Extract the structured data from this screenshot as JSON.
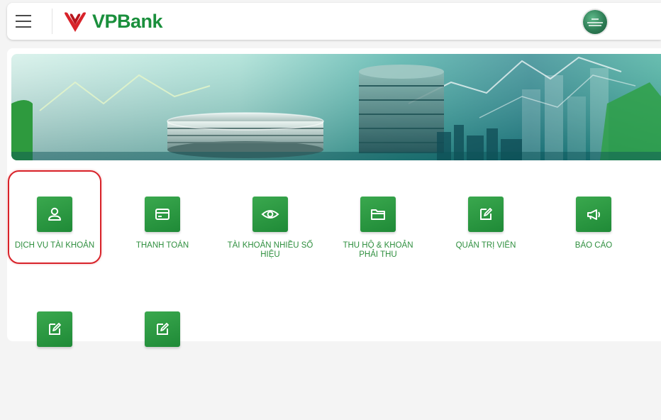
{
  "header": {
    "menu_icon": "hamburger-menu-icon",
    "logo": {
      "prefix": "VP",
      "suffix": "Bank",
      "text": "VPBank",
      "color": "#1a8f3c",
      "mark_color": "#d8232a"
    },
    "avatar_icon": "user-avatar"
  },
  "banner": {
    "description_icon": "finance-banner-image"
  },
  "services": [
    {
      "label": "DỊCH VỤ TÀI KHOẢN",
      "icon": "user-icon",
      "selected": true
    },
    {
      "label": "THANH TOÁN",
      "icon": "card-icon",
      "selected": false
    },
    {
      "label": "TÀI KHOẢN NHIỀU SỐ HIỆU",
      "icon": "eye-icon",
      "selected": false
    },
    {
      "label": "THU HỘ & KHOẢN PHẢI THU",
      "icon": "folder-icon",
      "selected": false
    },
    {
      "label": "QUẢN TRỊ VIÊN",
      "icon": "edit-icon",
      "selected": false
    },
    {
      "label": "BÁO CÁO",
      "icon": "megaphone-icon",
      "selected": false
    },
    {
      "label": "",
      "icon": "edit-icon",
      "selected": false
    },
    {
      "label": "",
      "icon": "edit-icon",
      "selected": false
    }
  ],
  "colors": {
    "accent": "#2f8f3f",
    "highlight": "#d8232a",
    "tile": "#2a9a44"
  }
}
